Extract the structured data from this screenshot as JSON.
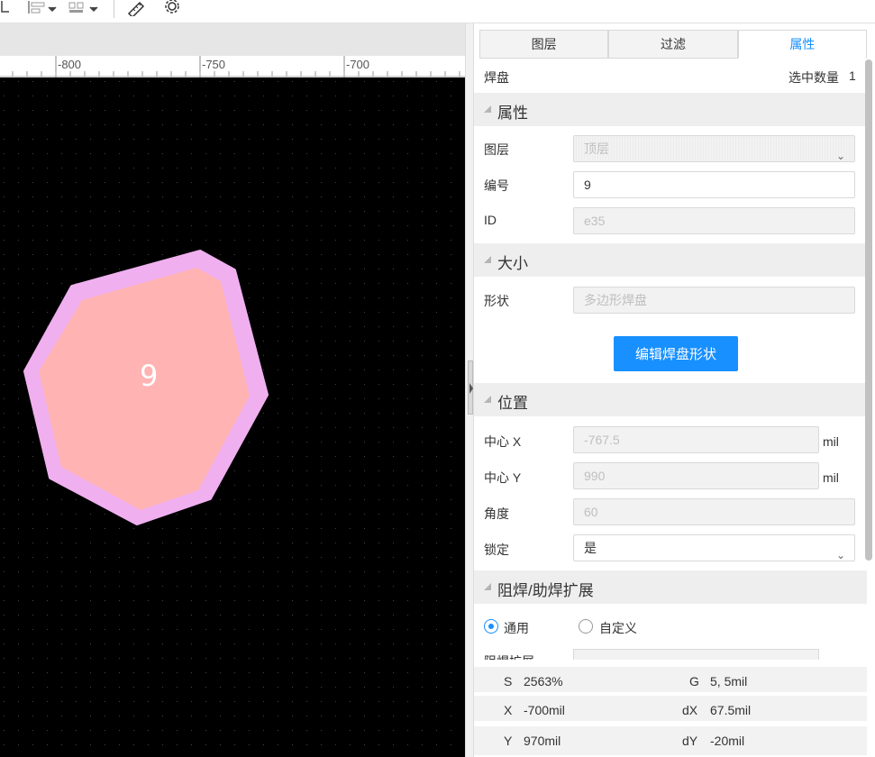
{
  "panel": {
    "tabs": [
      "图层",
      "过滤",
      "属性"
    ],
    "active_tab": "属性",
    "object_type": "焊盘",
    "selected_count_label": "选中数量",
    "selected_count": "1",
    "sections": {
      "props": "属性",
      "size": "大小",
      "position": "位置",
      "mask": "阻焊/助焊扩展"
    },
    "fields": {
      "layer_label": "图层",
      "layer_value": "顶层",
      "number_label": "编号",
      "number_value": "9",
      "id_label": "ID",
      "id_value": "e35",
      "shape_label": "形状",
      "shape_value": "多边形焊盘",
      "edit_button": "编辑焊盘形状",
      "cx_label": "中心 X",
      "cx_value": "-767.5",
      "cy_label": "中心 Y",
      "cy_value": "990",
      "unit": "mil",
      "angle_label": "角度",
      "angle_value": "60",
      "lock_label": "锁定",
      "lock_value": "是",
      "radio_general": "通用",
      "radio_custom": "自定义",
      "partial_label": "阻焊扩展"
    }
  },
  "ruler": {
    "ticks": [
      "-800",
      "-750",
      "-700"
    ]
  },
  "canvas": {
    "pad_number": "9",
    "pad_fill": "#ffb3b3",
    "pad_outline": "#f0b0f0"
  },
  "status": {
    "s_key": "S",
    "s_val": "2563%",
    "g_key": "G",
    "g_val": "5, 5mil",
    "x_key": "X",
    "x_val": "-700mil",
    "dx_key": "dX",
    "dx_val": "67.5mil",
    "y_key": "Y",
    "y_val": "970mil",
    "dy_key": "dY",
    "dy_val": "-20mil"
  },
  "colors": {
    "accent": "#1890ff",
    "canvas_bg": "#000000"
  }
}
